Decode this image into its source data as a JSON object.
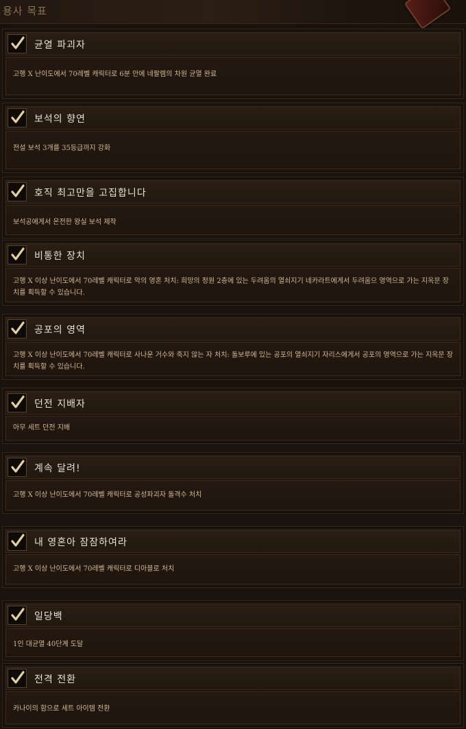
{
  "header": {
    "title": "용사 목표"
  },
  "achievements": [
    {
      "title": "균열 파괴자",
      "description": "고행 X 난이도에서 70레벨 캐릭터로 6분 안에 네팔렘의 차원 균열 완료",
      "completed": true
    },
    {
      "title": "보석의 향연",
      "description": "전설 보석 3개를 35등급까지 강화",
      "completed": true
    },
    {
      "title": "호직 최고만을 고집합니다",
      "description": "보석공에게서 온전한 왕실 보석 제작",
      "completed": true
    },
    {
      "title": "비통한 장치",
      "description": "고행 X 이상 난이도에서 70레벨 캐릭터로 악의 영혼 처치: 희망의 정원 2층에 있는 두려움의 열쇠지기 네카라트에게서 두려움으 영역으로 가는 지옥문 장치를 획득할 수 있습니다.",
      "completed": true
    },
    {
      "title": "공포의 영역",
      "description": "고행 X 이상 난이도에서 70레벨 캐릭터로 사나운 거수와 죽지 않는 자 처치: 돌보루에 있는 공포의 열쇠지기 자리스에게서 공포의 영역으로 가는 지옥문 장치를 획득할 수 있습니다.",
      "completed": true
    },
    {
      "title": "던전 지배자",
      "description": "아무 세트 던전 지배",
      "completed": true
    },
    {
      "title": "계속 달려!",
      "description": "고행 X 이상 난이도에서 70레벨 캐릭터로 공성파괴자 돌격수 처치",
      "completed": true
    },
    {
      "title": "내 영혼아 잠잠하여라",
      "description": "고행 X 이상 난이도에서 70레벨 캐릭터로 디아블로 처치",
      "completed": true
    },
    {
      "title": "일당백",
      "description": "1인 대균열 40단계 도달",
      "completed": true
    },
    {
      "title": "전격 전환",
      "description": "카나이의 함으로 세트 아이템 전환",
      "completed": true
    }
  ]
}
